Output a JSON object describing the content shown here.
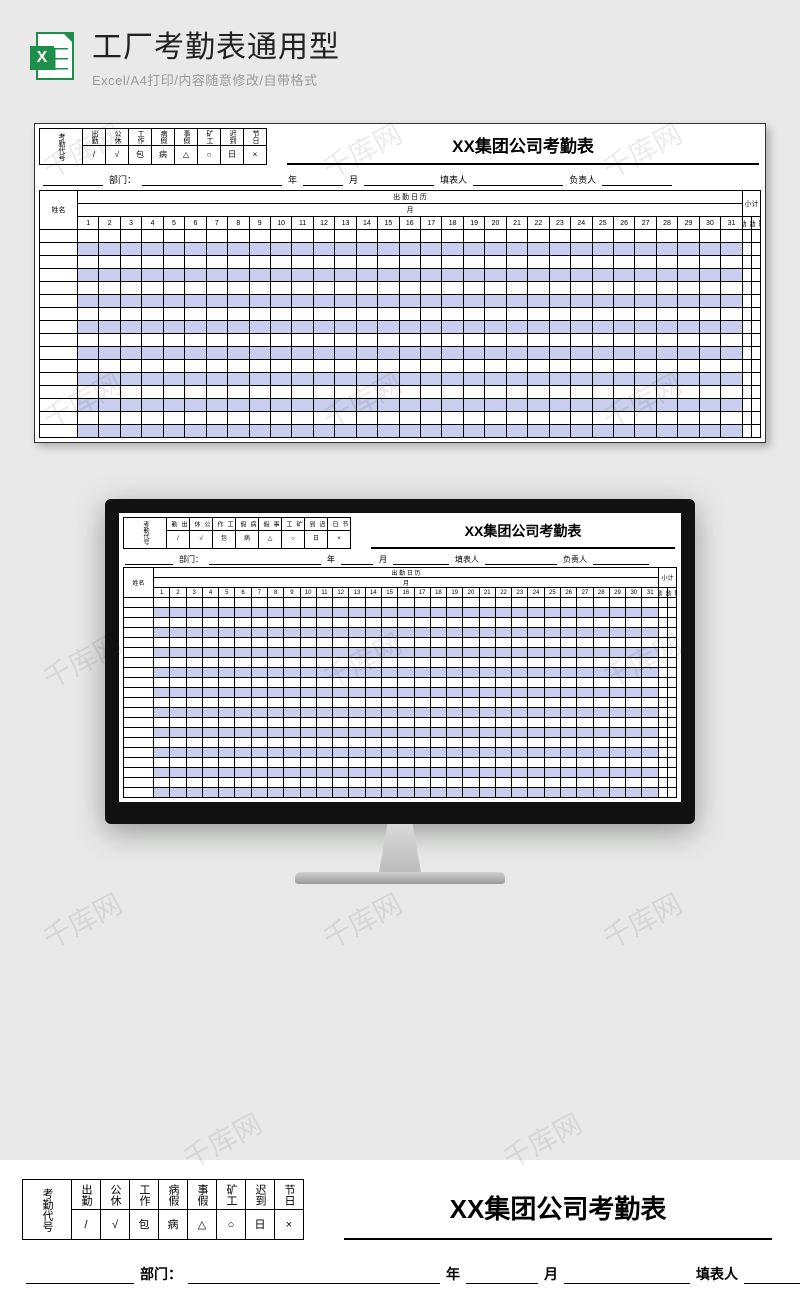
{
  "watermark": "千库网",
  "header": {
    "icon_letter": "X",
    "title": "工厂考勤表通用型",
    "subtitle": "Excel/A4打印/内容随意修改/自带格式"
  },
  "sheet": {
    "title": "XX集团公司考勤表",
    "legend_label": "考勤代号",
    "legend_headers": [
      "出勤",
      "公休",
      "工作",
      "病假",
      "事假",
      "矿工",
      "迟到",
      "节日"
    ],
    "legend_symbols": [
      "/",
      "√",
      "包",
      "病",
      "△",
      "○",
      "日",
      "×"
    ],
    "form": {
      "dept_label": "部门：",
      "year_label": "年",
      "month_label": "月",
      "filler_label": "填表人",
      "owner_label": "负责人"
    },
    "name_header": "姓名",
    "calendar_header": "出   勤   日   历",
    "month_marker": "月",
    "days": [
      "1",
      "2",
      "3",
      "4",
      "5",
      "6",
      "7",
      "8",
      "9",
      "10",
      "11",
      "12",
      "13",
      "14",
      "15",
      "16",
      "17",
      "18",
      "19",
      "20",
      "21",
      "22",
      "23",
      "24",
      "25",
      "26",
      "27",
      "28",
      "29",
      "30",
      "31"
    ],
    "subtotal_header": "小计",
    "subtotal_cols": [
      "出勤",
      "缺勤"
    ],
    "body_rows": 16,
    "screen_body_rows": 20
  }
}
